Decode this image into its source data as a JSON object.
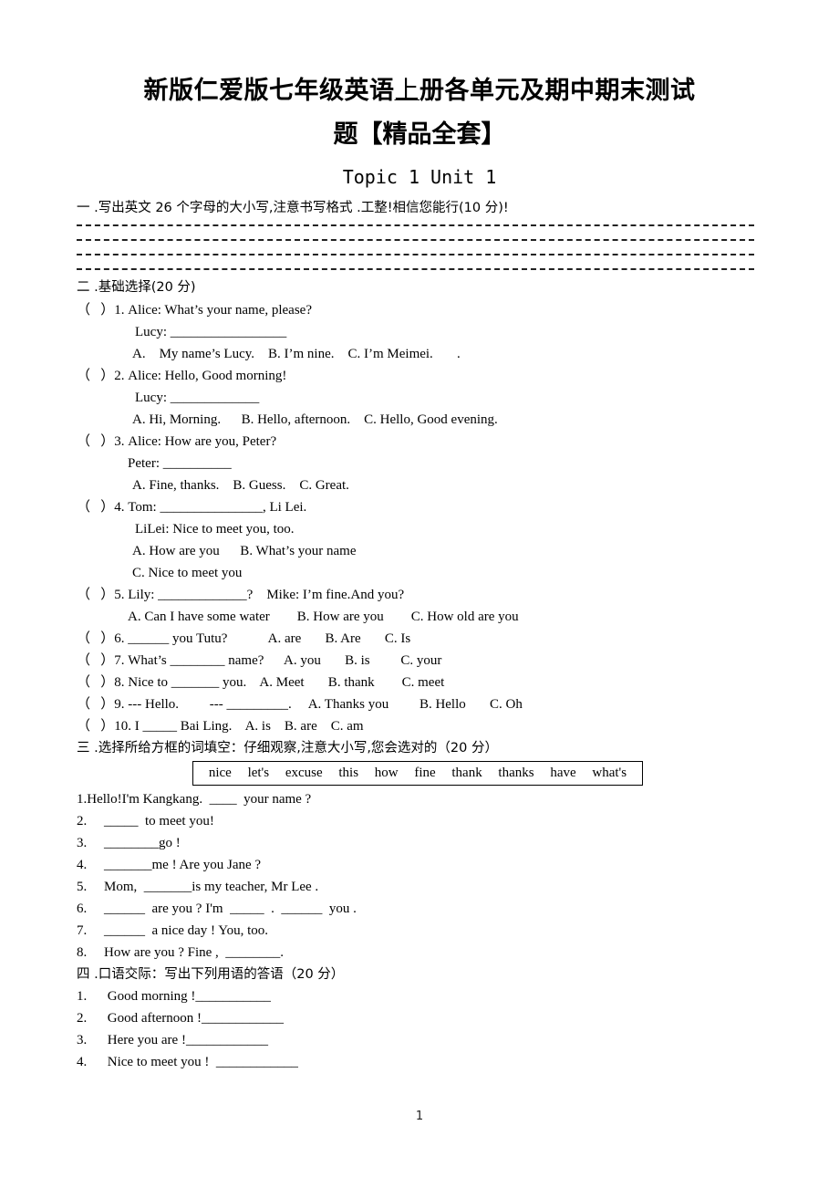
{
  "header": {
    "title_part1": "新版仁爱版七年级英语",
    "title_mid": "上",
    "title_part2": "册各单元及期中期末测试",
    "title_line2": "题【精品全套】",
    "subtitle": "Topic 1 Unit 1"
  },
  "section1": {
    "heading": "一 .写出英文 26 个字母的大小写,注意书写格式 .工整!相信您能行(10 分)!",
    "dashed_line_count": 4
  },
  "section2": {
    "heading": "二 .基础选择(20 分)",
    "lines": [
      "（   ）1. Alice: What’s your name, please?",
      "Lucy: _________________",
      "A.    My name’s Lucy.    B. I’m nine.    C. I’m Meimei.       .",
      "（   ）2. Alice: Hello, Good morning!",
      "Lucy: _____________",
      "A. Hi, Morning.      B. Hello, afternoon.    C. Hello, Good evening.",
      "（   ）3. Alice: How are you, Peter?",
      "Peter: __________",
      "A. Fine, thanks.    B. Guess.    C. Great.",
      "（   ）4. Tom: _______________, Li Lei.",
      "LiLei: Nice to meet you, too.",
      "A. How are you      B. What’s your name",
      "C. Nice to meet you",
      "（   ）5. Lily: _____________?    Mike: I’m fine.And you?",
      "A. Can I have some water        B. How are you        C. How old are you",
      "（   ）6. ______ you Tutu?            A. are       B. Are       C. Is",
      "（   ）7. What’s ________ name?      A. you       B. is         C. your",
      "（   ）8. Nice to _______ you.    A. Meet       B. thank        C. meet",
      "（   ）9. --- Hello.         --- _________.     A. Thanks you         B. Hello       C. Oh",
      "（   ）10. I _____ Bai Ling.    A. is    B. are    C. am"
    ]
  },
  "section3": {
    "heading": "三 .选择所给方框的词填空：仔细观察,注意大小写,您会选对的（20 分）",
    "word_bank": [
      "nice",
      "let's",
      "excuse",
      "this",
      "how",
      "fine",
      "thank",
      "thanks",
      "have",
      "what's"
    ],
    "items": [
      "1.Hello!I'm Kangkang.  ____  your name ?",
      "2.     _____  to meet you!",
      "3.     ________go !",
      "4.     _______me ! Are you Jane ?",
      "5.     Mom,  _______is my teacher, Mr Lee .",
      "6.     ______  are you ? I'm  _____  .  ______  you .",
      "7.     ______  a nice day ! You, too.",
      "8.     How are you ? Fine ,  ________."
    ]
  },
  "section4": {
    "heading": "四 .口语交际：写出下列用语的答语（20 分）",
    "items": [
      "1.      Good morning !___________",
      "2.      Good afternoon !____________",
      "3.      Here you are !____________",
      "4.      Nice to meet you !  ____________"
    ]
  },
  "footer": {
    "page_number": "1"
  }
}
